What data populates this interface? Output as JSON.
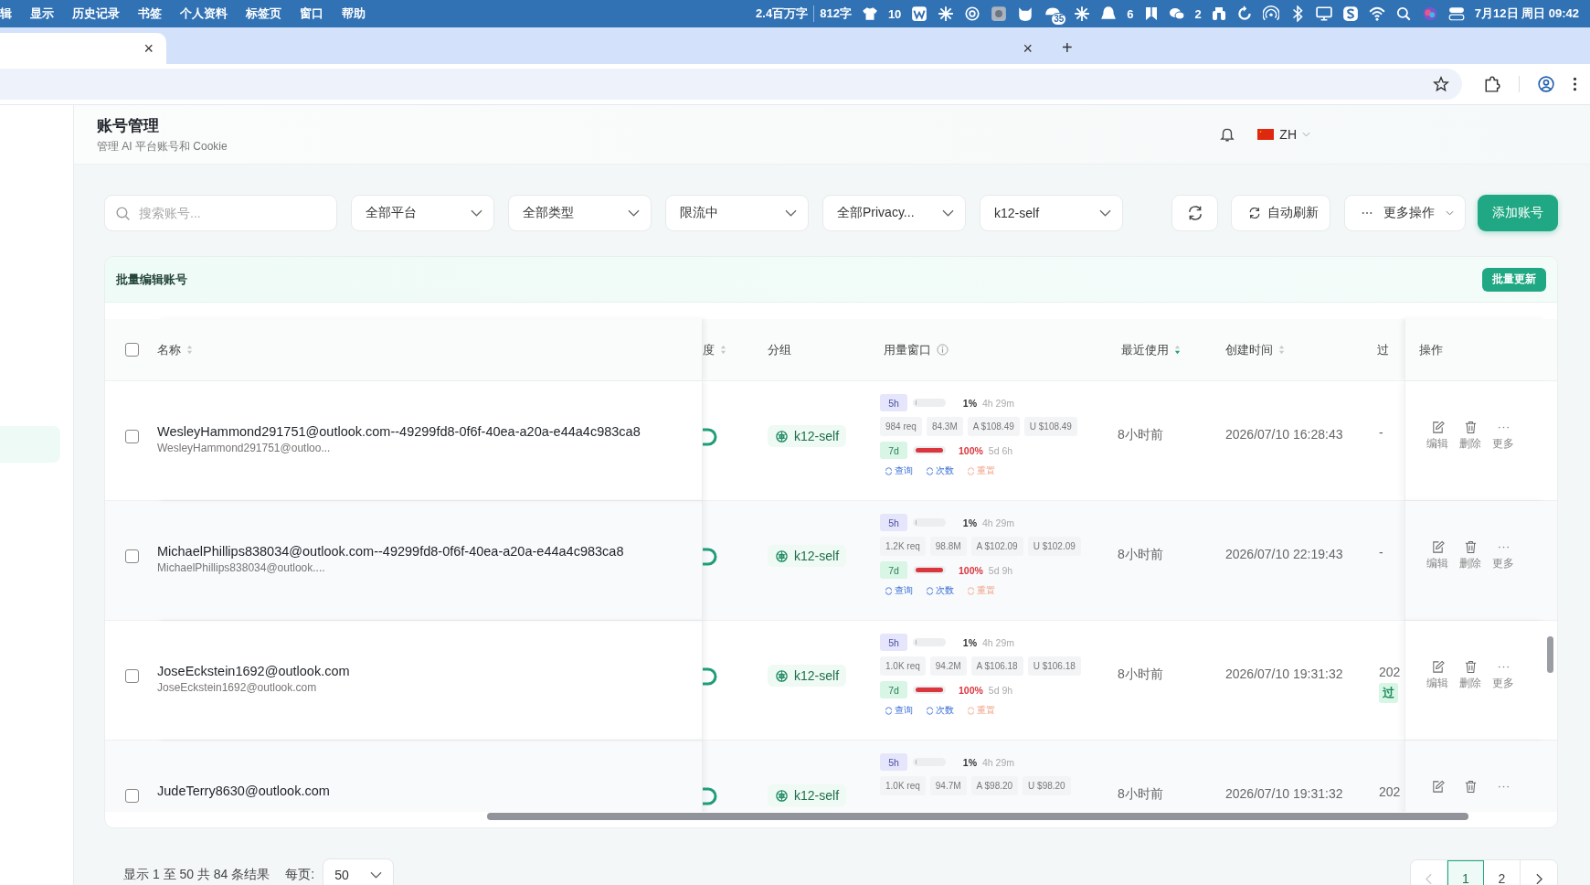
{
  "menu_bar": {
    "items": [
      "辑",
      "显示",
      "历史记录",
      "书签",
      "个人资料",
      "标签页",
      "窗口",
      "帮助"
    ],
    "word_count": "2.4百万字",
    "char_count": "812字",
    "shirt_count": "10",
    "calendar_badge": "35",
    "penguin_count": "6",
    "chat_count": "2",
    "datetime": "7月12日 周日 09:42"
  },
  "browser": {
    "tabs": [
      {
        "selected": true,
        "close": "×"
      },
      {
        "selected": false,
        "close": "×"
      }
    ],
    "new_tab": "+"
  },
  "header": {
    "title": "账号管理",
    "subtitle": "管理 AI 平台账号和 Cookie",
    "language": "ZH"
  },
  "filters": {
    "search_placeholder": "搜索账号...",
    "selects": [
      "全部平台",
      "全部类型",
      "限流中",
      "全部Privacy...",
      "k12-self"
    ],
    "auto_refresh": "自动刷新",
    "more": "更多操作",
    "add": "添加账号"
  },
  "batch": {
    "title": "批量编辑账号",
    "button": "批量更新"
  },
  "table": {
    "select_all": {
      "checked": false
    },
    "columns": [
      {
        "label": "名称",
        "sortable": true,
        "sort_active": false
      },
      {
        "label": "度",
        "sortable": true,
        "sort_active": false
      },
      {
        "label": "分组"
      },
      {
        "label": "用量窗口",
        "info": true
      },
      {
        "label": "最近使用",
        "sortable": true,
        "sort_active": true
      },
      {
        "label": "创建时间",
        "sortable": true,
        "sort_active": false
      },
      {
        "label": "过"
      },
      {
        "label": "操作"
      }
    ],
    "rows": [
      {
        "checked": false,
        "name": "WesleyHammond291751@outlook.com--49299fd8-0f6f-40ea-a20a-e44a4c983ca8",
        "email": "WesleyHammond291751@outloo...",
        "enabled": true,
        "group": "k12-self",
        "w5h": {
          "label": "5h",
          "level": 0.01,
          "percent": "1%",
          "reset": "4h 29m"
        },
        "stats": [
          "984 req",
          "84.3M",
          "A $108.49",
          "U $108.49"
        ],
        "w7d": {
          "label": "7d",
          "level": 1,
          "percent": "100%",
          "reset": "5d 6h"
        },
        "usage_actions": [
          {
            "kind": "query",
            "label": "查询"
          },
          {
            "kind": "count",
            "label": "次数"
          },
          {
            "kind": "reset",
            "label": "重置"
          }
        ],
        "last_used": "8小时前",
        "created": "2026/07/10 16:28:43",
        "expires": {
          "text": "-"
        },
        "ops": [
          {
            "kind": "edit",
            "label": "编辑"
          },
          {
            "kind": "delete",
            "label": "删除"
          },
          {
            "kind": "more",
            "label": "更多"
          }
        ]
      },
      {
        "checked": false,
        "name": "MichaelPhillips838034@outlook.com--49299fd8-0f6f-40ea-a20a-e44a4c983ca8",
        "email": "MichaelPhillips838034@outlook....",
        "enabled": true,
        "group": "k12-self",
        "w5h": {
          "label": "5h",
          "level": 0.01,
          "percent": "1%",
          "reset": "4h 29m"
        },
        "stats": [
          "1.2K req",
          "98.8M",
          "A $102.09",
          "U $102.09"
        ],
        "w7d": {
          "label": "7d",
          "level": 1,
          "percent": "100%",
          "reset": "5d 9h"
        },
        "usage_actions": [
          {
            "kind": "query",
            "label": "查询"
          },
          {
            "kind": "count",
            "label": "次数"
          },
          {
            "kind": "reset",
            "label": "重置"
          }
        ],
        "last_used": "8小时前",
        "created": "2026/07/10 22:19:43",
        "expires": {
          "text": "-"
        },
        "ops": [
          {
            "kind": "edit",
            "label": "编辑"
          },
          {
            "kind": "delete",
            "label": "删除"
          },
          {
            "kind": "more",
            "label": "更多"
          }
        ]
      },
      {
        "checked": false,
        "name": "JoseEckstein1692@outlook.com",
        "email": "JoseEckstein1692@outlook.com",
        "enabled": true,
        "group": "k12-self",
        "w5h": {
          "label": "5h",
          "level": 0.01,
          "percent": "1%",
          "reset": "4h 29m"
        },
        "stats": [
          "1.0K req",
          "94.2M",
          "A $106.18",
          "U $106.18"
        ],
        "w7d": {
          "label": "7d",
          "level": 1,
          "percent": "100%",
          "reset": "5d 9h"
        },
        "usage_actions": [
          {
            "kind": "query",
            "label": "查询"
          },
          {
            "kind": "count",
            "label": "次数"
          },
          {
            "kind": "reset",
            "label": "重置"
          }
        ],
        "last_used": "8小时前",
        "created": "2026/07/10 19:31:32",
        "expires": {
          "text": "202",
          "tag": "过"
        },
        "ops": [
          {
            "kind": "edit",
            "label": "编辑"
          },
          {
            "kind": "delete",
            "label": "删除"
          },
          {
            "kind": "more",
            "label": "更多"
          }
        ]
      },
      {
        "checked": false,
        "name": "JudeTerry8630@outlook.com",
        "enabled": true,
        "group": "k12-self",
        "w5h": {
          "label": "5h",
          "level": 0.01,
          "percent": "1%",
          "reset": "4h 29m"
        },
        "stats": [
          "1.0K req",
          "94.7M",
          "A $98.20",
          "U $98.20"
        ],
        "last_used": "8小时前",
        "created": "2026/07/10 19:31:32",
        "expires": {
          "text": "202"
        },
        "ops": [
          {
            "kind": "edit"
          },
          {
            "kind": "delete"
          },
          {
            "kind": "more"
          }
        ]
      }
    ]
  },
  "pagination": {
    "summary": "显示 1 至 50 共 84 条结果",
    "per_page_label": "每页:",
    "per_page": "50",
    "prev_disabled": true,
    "pages": [
      {
        "label": "1",
        "selected": true
      },
      {
        "label": "2",
        "selected": false
      }
    ]
  }
}
